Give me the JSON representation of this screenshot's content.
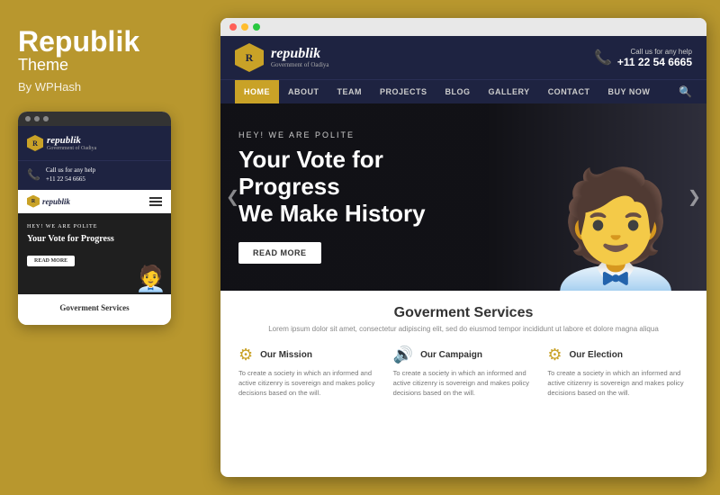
{
  "left": {
    "title": "Republik",
    "subtitle": "Theme",
    "by": "By WPHash",
    "mobile": {
      "dots": [
        "dot1",
        "dot2",
        "dot3"
      ],
      "logo": "republik",
      "logo_sub": "Government of Oadiya",
      "contact_label": "Call us for any help",
      "contact_number": "+11 22 54 6665",
      "hero_pretitle": "HEY! WE ARE POLITE",
      "hero_title": "Your Vote for Progress",
      "read_more": "READ MORE",
      "services_title": "Goverment Services"
    }
  },
  "right": {
    "desktop": {
      "logo": "republik",
      "logo_sub": "Government of Oadiya",
      "contact_label": "Call us for any help",
      "contact_number": "+11 22 54 6665",
      "nav": [
        "HOME",
        "ABOUT",
        "TEAM",
        "PROJECTS",
        "BLOG",
        "GALLERY",
        "CONTACT",
        "BUY NOW"
      ],
      "nav_active": "HOME",
      "hero_pretitle": "HEY! WE ARE POLITE",
      "hero_title_line1": "Your Vote for Progress",
      "hero_title_line2": "We Make History",
      "read_more": "READ MORE",
      "services_title": "Goverment Services",
      "services_desc": "Lorem ipsum dolor sit amet, consectetur adipiscing elit, sed do eiusmod tempor incididunt ut labore et dolore magna aliqua",
      "services": [
        {
          "icon": "⚙",
          "name": "Our Mission",
          "text": "To create a society in which an informed and active citizenry is sovereign and makes policy decisions based on the will."
        },
        {
          "icon": "🔊",
          "name": "Our Campaign",
          "text": "To create a society in which an informed and active citizenry is sovereign and makes policy decisions based on the will."
        },
        {
          "icon": "⚙",
          "name": "Our Election",
          "text": "To create a society in which an informed and active citizenry is sovereign and makes policy decisions based on the will."
        }
      ]
    }
  },
  "colors": {
    "gold": "#c9a227",
    "dark_navy": "#1e2341",
    "bg_gold": "#b8972e"
  }
}
